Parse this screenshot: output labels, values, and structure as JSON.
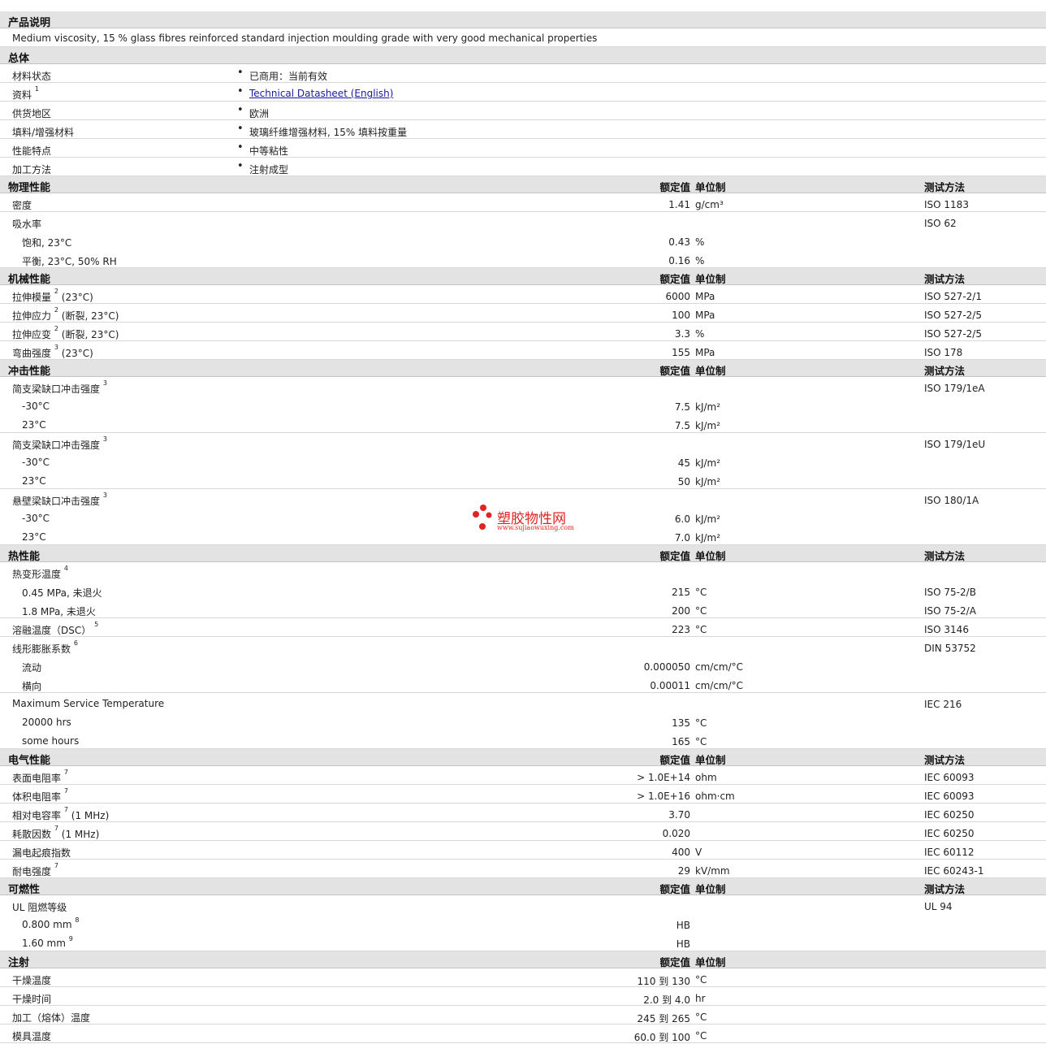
{
  "desc_header": "产品说明",
  "description": "Medium viscosity, 15 % glass fibres reinforced standard injection moulding grade with very good mechanical properties",
  "general": {
    "title": "总体",
    "rows": [
      {
        "label": "材料状态",
        "sup": "",
        "value": "已商用：当前有效",
        "link": false
      },
      {
        "label": "资料",
        "sup": "1",
        "value": "Technical Datasheet (English)",
        "link": true
      },
      {
        "label": "供货地区",
        "sup": "",
        "value": "欧洲",
        "link": false
      },
      {
        "label": "填料/增强材料",
        "sup": "",
        "value": "玻璃纤维增强材料, 15% 填料按重量",
        "link": false
      },
      {
        "label": "性能特点",
        "sup": "",
        "value": "中等粘性",
        "link": false
      },
      {
        "label": "加工方法",
        "sup": "",
        "value": "注射成型",
        "link": false
      }
    ]
  },
  "col_headers": {
    "value": "额定值",
    "unit": "单位制",
    "method": "测试方法"
  },
  "sections": [
    {
      "title": "物理性能",
      "show_method": true,
      "rows": [
        {
          "label": "密度",
          "sup": "",
          "suffix": "",
          "indent": false,
          "value": "1.41",
          "unit": "g/cm³",
          "method": "ISO 1183"
        },
        {
          "label": "吸水率",
          "sup": "",
          "suffix": "",
          "indent": false,
          "value": "",
          "unit": "",
          "method": "ISO 62",
          "nb": true
        },
        {
          "label": "饱和, 23°C",
          "sup": "",
          "suffix": "",
          "indent": true,
          "value": "0.43",
          "unit": "%",
          "method": "",
          "nb": true
        },
        {
          "label": "平衡, 23°C, 50% RH",
          "sup": "",
          "suffix": "",
          "indent": true,
          "value": "0.16",
          "unit": "%",
          "method": ""
        }
      ]
    },
    {
      "title": "机械性能",
      "show_method": true,
      "rows": [
        {
          "label": "拉伸模量",
          "sup": "2",
          "suffix": "(23°C)",
          "indent": false,
          "value": "6000",
          "unit": "MPa",
          "method": "ISO 527-2/1"
        },
        {
          "label": "拉伸应力",
          "sup": "2",
          "suffix": "(断裂, 23°C)",
          "indent": false,
          "value": "100",
          "unit": "MPa",
          "method": "ISO 527-2/5"
        },
        {
          "label": "拉伸应变",
          "sup": "2",
          "suffix": "(断裂, 23°C)",
          "indent": false,
          "value": "3.3",
          "unit": "%",
          "method": "ISO 527-2/5"
        },
        {
          "label": "弯曲强度",
          "sup": "3",
          "suffix": "(23°C)",
          "indent": false,
          "value": "155",
          "unit": "MPa",
          "method": "ISO 178"
        }
      ]
    },
    {
      "title": "冲击性能",
      "show_method": true,
      "rows": [
        {
          "label": "简支梁缺口冲击强度",
          "sup": "3",
          "suffix": "",
          "indent": false,
          "value": "",
          "unit": "",
          "method": "ISO 179/1eA",
          "nb": true
        },
        {
          "label": "-30°C",
          "sup": "",
          "suffix": "",
          "indent": true,
          "value": "7.5",
          "unit": "kJ/m²",
          "method": "",
          "nb": true
        },
        {
          "label": "23°C",
          "sup": "",
          "suffix": "",
          "indent": true,
          "value": "7.5",
          "unit": "kJ/m²",
          "method": ""
        },
        {
          "label": "简支梁缺口冲击强度",
          "sup": "3",
          "suffix": "",
          "indent": false,
          "value": "",
          "unit": "",
          "method": "ISO 179/1eU",
          "nb": true
        },
        {
          "label": "-30°C",
          "sup": "",
          "suffix": "",
          "indent": true,
          "value": "45",
          "unit": "kJ/m²",
          "method": "",
          "nb": true
        },
        {
          "label": "23°C",
          "sup": "",
          "suffix": "",
          "indent": true,
          "value": "50",
          "unit": "kJ/m²",
          "method": ""
        },
        {
          "label": "悬壁梁缺口冲击强度",
          "sup": "3",
          "suffix": "",
          "indent": false,
          "value": "",
          "unit": "",
          "method": "ISO 180/1A",
          "nb": true
        },
        {
          "label": "-30°C",
          "sup": "",
          "suffix": "",
          "indent": true,
          "value": "6.0",
          "unit": "kJ/m²",
          "method": "",
          "nb": true
        },
        {
          "label": "23°C",
          "sup": "",
          "suffix": "",
          "indent": true,
          "value": "7.0",
          "unit": "kJ/m²",
          "method": ""
        }
      ]
    },
    {
      "title": "热性能",
      "show_method": true,
      "rows": [
        {
          "label": "热变形温度",
          "sup": "4",
          "suffix": "",
          "indent": false,
          "value": "",
          "unit": "",
          "method": "",
          "nb": true
        },
        {
          "label": "0.45 MPa, 未退火",
          "sup": "",
          "suffix": "",
          "indent": true,
          "value": "215",
          "unit": "°C",
          "method": "ISO 75-2/B",
          "nb": true
        },
        {
          "label": "1.8 MPa, 未退火",
          "sup": "",
          "suffix": "",
          "indent": true,
          "value": "200",
          "unit": "°C",
          "method": "ISO 75-2/A"
        },
        {
          "label": "溶融温度（DSC）",
          "sup": "5",
          "suffix": "",
          "indent": false,
          "value": "223",
          "unit": "°C",
          "method": "ISO 3146"
        },
        {
          "label": "线形膨胀系数",
          "sup": "6",
          "suffix": "",
          "indent": false,
          "value": "",
          "unit": "",
          "method": "DIN 53752",
          "nb": true
        },
        {
          "label": "流动",
          "sup": "",
          "suffix": "",
          "indent": true,
          "value": "0.000050",
          "unit": "cm/cm/°C",
          "method": "",
          "nb": true
        },
        {
          "label": "横向",
          "sup": "",
          "suffix": "",
          "indent": true,
          "value": "0.00011",
          "unit": "cm/cm/°C",
          "method": ""
        },
        {
          "label": "Maximum Service Temperature",
          "sup": "",
          "suffix": "",
          "indent": false,
          "value": "",
          "unit": "",
          "method": "IEC 216",
          "nb": true
        },
        {
          "label": "20000 hrs",
          "sup": "",
          "suffix": "",
          "indent": true,
          "value": "135",
          "unit": "°C",
          "method": "",
          "nb": true
        },
        {
          "label": "some hours",
          "sup": "",
          "suffix": "",
          "indent": true,
          "value": "165",
          "unit": "°C",
          "method": ""
        }
      ]
    },
    {
      "title": "电气性能",
      "show_method": true,
      "rows": [
        {
          "label": "表面电阻率",
          "sup": "7",
          "suffix": "",
          "indent": false,
          "value": "> 1.0E+14",
          "unit": "ohm",
          "method": "IEC 60093"
        },
        {
          "label": "体积电阻率",
          "sup": "7",
          "suffix": "",
          "indent": false,
          "value": "> 1.0E+16",
          "unit": "ohm·cm",
          "method": "IEC 60093"
        },
        {
          "label": "相对电容率",
          "sup": "7",
          "suffix": "(1 MHz)",
          "indent": false,
          "value": "3.70",
          "unit": "",
          "method": "IEC 60250"
        },
        {
          "label": "耗散因数",
          "sup": "7",
          "suffix": "(1 MHz)",
          "indent": false,
          "value": "0.020",
          "unit": "",
          "method": "IEC 60250"
        },
        {
          "label": "漏电起痕指数",
          "sup": "",
          "suffix": "",
          "indent": false,
          "value": "400",
          "unit": "V",
          "method": "IEC 60112"
        },
        {
          "label": "耐电强度",
          "sup": "7",
          "suffix": "",
          "indent": false,
          "value": "29",
          "unit": "kV/mm",
          "method": "IEC 60243-1"
        }
      ]
    },
    {
      "title": "可燃性",
      "show_method": true,
      "rows": [
        {
          "label": "UL 阻燃等级",
          "sup": "",
          "suffix": "",
          "indent": false,
          "value": "",
          "unit": "",
          "method": "UL 94",
          "nb": true
        },
        {
          "label": "0.800 mm",
          "sup": "8",
          "suffix": "",
          "indent": true,
          "value": "HB",
          "unit": "",
          "method": "",
          "nb": true
        },
        {
          "label": "1.60 mm",
          "sup": "9",
          "suffix": "",
          "indent": true,
          "value": "HB",
          "unit": "",
          "method": ""
        }
      ]
    },
    {
      "title": "注射",
      "show_method": false,
      "rows": [
        {
          "label": "干燥温度",
          "sup": "",
          "suffix": "",
          "indent": false,
          "value": "110 到 130",
          "unit": "°C",
          "method": ""
        },
        {
          "label": "干燥时间",
          "sup": "",
          "suffix": "",
          "indent": false,
          "value": "2.0 到 4.0",
          "unit": "hr",
          "method": ""
        },
        {
          "label": "加工（熔体）温度",
          "sup": "",
          "suffix": "",
          "indent": false,
          "value": "245 到 265",
          "unit": "°C",
          "method": ""
        },
        {
          "label": "模具温度",
          "sup": "",
          "suffix": "",
          "indent": false,
          "value": "60.0 到 100",
          "unit": "°C",
          "method": ""
        }
      ]
    }
  ],
  "watermark": {
    "text": "塑胶物性网",
    "url": "www.sujiaowuxing.com"
  }
}
